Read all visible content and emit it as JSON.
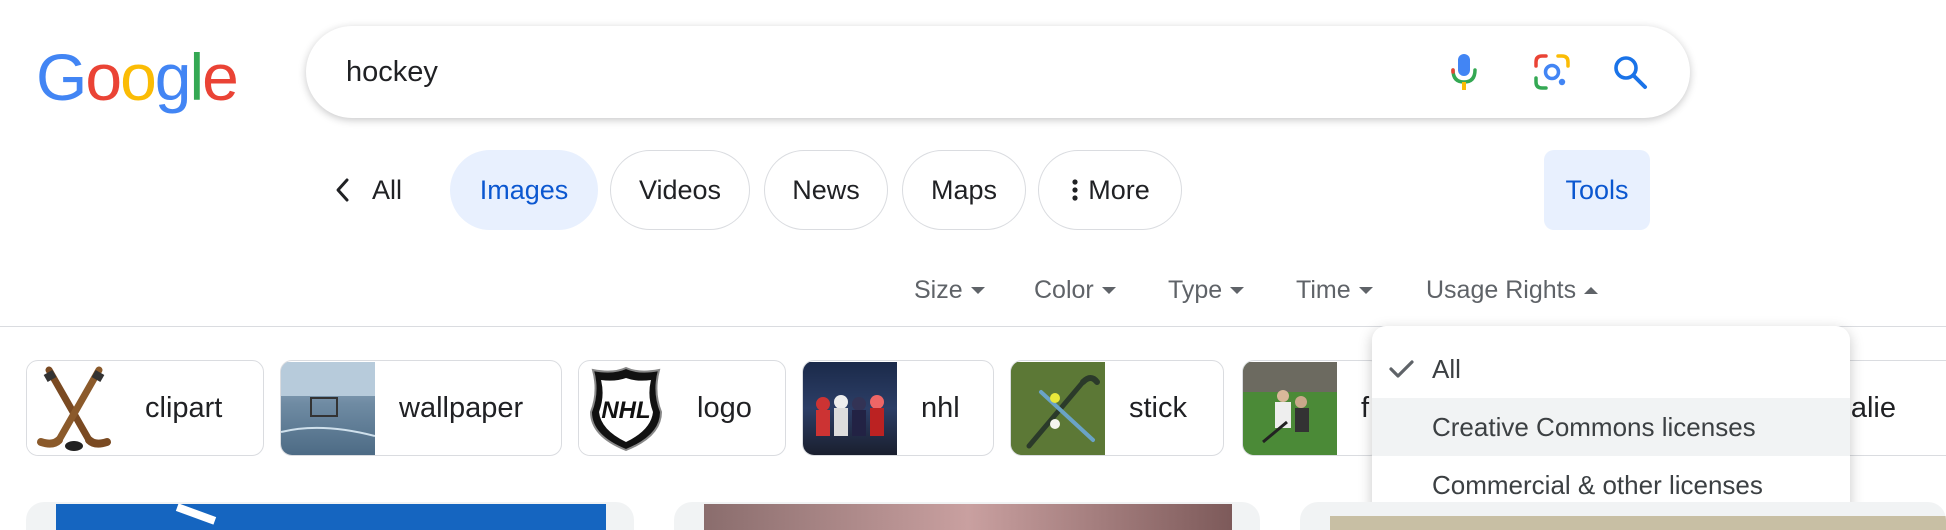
{
  "logo": {
    "text": "Google"
  },
  "search": {
    "query": "hockey",
    "mic_icon": "microphone-icon",
    "lens_icon": "camera-lens-icon",
    "search_icon": "search-icon"
  },
  "tabs": {
    "back_label": "All",
    "items": [
      {
        "label": "Images",
        "active": true
      },
      {
        "label": "Videos"
      },
      {
        "label": "News"
      },
      {
        "label": "Maps"
      },
      {
        "label": "More"
      }
    ],
    "tools_label": "Tools"
  },
  "filters": {
    "size": "Size",
    "color": "Color",
    "type": "Type",
    "time": "Time",
    "usage_rights": "Usage Rights"
  },
  "chips": [
    {
      "label": "clipart"
    },
    {
      "label": "wallpaper"
    },
    {
      "label": "logo"
    },
    {
      "label": "nhl"
    },
    {
      "label": "stick"
    },
    {
      "label": "f"
    },
    {
      "label": "alie"
    }
  ],
  "usage_rights_menu": {
    "items": [
      {
        "label": "All",
        "selected": true
      },
      {
        "label": "Creative Commons licenses",
        "hovered": true
      },
      {
        "label": "Commercial & other licenses"
      }
    ]
  },
  "colors": {
    "google_blue": "#4285F4",
    "google_red": "#EA4335",
    "google_yellow": "#FBBC05",
    "google_green": "#34A853",
    "active_tab_bg": "#e8f0fe",
    "active_tab_text": "#0b57d0"
  }
}
